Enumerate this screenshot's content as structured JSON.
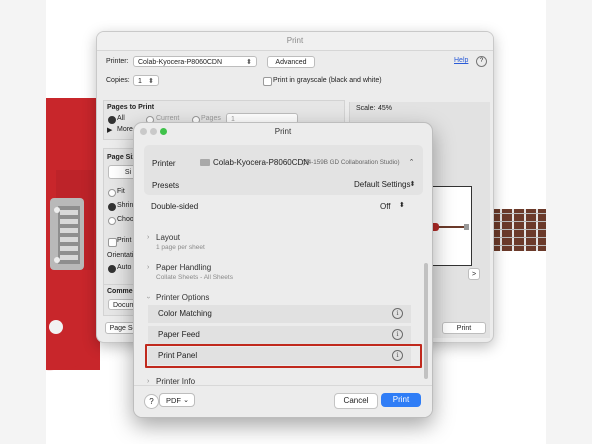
{
  "back_dialog": {
    "title": "Print",
    "printer_label": "Printer:",
    "printer_value": "Colab-Kyocera-P8060CDN",
    "advanced_button": "Advanced",
    "help_link": "Help",
    "copies_label": "Copies:",
    "copies_value": "1",
    "grayscale_label": "Print in grayscale (black and white)",
    "pages_to_print_heading": "Pages to Print",
    "pages_all": "All",
    "pages_current": "Current",
    "pages_pages": "Pages",
    "pages_range_value": "1",
    "pages_more": "More",
    "page_size_heading": "Page Siz",
    "page_size_tab": "Si",
    "fit_label": "Fit",
    "shrink_label": "Shrink",
    "choose_label": "Choos",
    "print_on_label": "Print o",
    "orientation_label": "Orientati",
    "orientation_auto": "Auto",
    "comments_label": "Commen",
    "comments_value": "Docum",
    "page_setup_button": "Page Se",
    "print_button": "Print",
    "scale_label": "Scale:",
    "scale_value": "45%",
    "nav_next": ">"
  },
  "front_dialog": {
    "title": "Print",
    "printer_label": "Printer",
    "printer_value": "Colab-Kyocera-P8060CDN",
    "printer_location": "(34-159B GD Collaboration Studio)",
    "presets_label": "Presets",
    "presets_value": "Default Settings",
    "double_sided_label": "Double-sided",
    "double_sided_value": "Off",
    "sections": {
      "layout": {
        "label": "Layout",
        "sub": "1 page per sheet"
      },
      "paper_handling": {
        "label": "Paper Handling",
        "sub": "Collate Sheets - All Sheets"
      },
      "printer_options": {
        "label": "Printer Options"
      },
      "printer_info": {
        "label": "Printer Info"
      }
    },
    "options": [
      {
        "label": "Color Matching"
      },
      {
        "label": "Paper Feed"
      },
      {
        "label": "Print Panel"
      }
    ],
    "help_button": "?",
    "pdf_button": "PDF",
    "cancel_button": "Cancel",
    "print_button": "Print"
  },
  "colors": {
    "guitar_red": "#c8262b",
    "highlight_red": "#c0291d",
    "accent_blue": "#2f7df6"
  }
}
